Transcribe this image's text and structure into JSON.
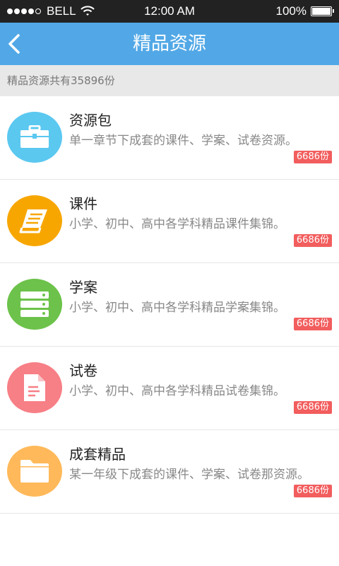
{
  "status_bar": {
    "carrier": "BELL",
    "time": "12:00 AM",
    "battery": "100%"
  },
  "nav": {
    "title": "精品资源",
    "back_icon": "chevron-left-icon"
  },
  "summary": {
    "text": "精品资源共有35896份"
  },
  "colors": {
    "nav_bar": "#52a8e6",
    "badge": "#f25d5d",
    "icon_resource_pack": "#5bc8f0",
    "icon_courseware": "#f7a600",
    "icon_lesson_plan": "#6cc24a",
    "icon_exam": "#f77f86",
    "icon_complete_set": "#ffb95a"
  },
  "items": [
    {
      "title": "资源包",
      "desc": "单一章节下成套的课件、学案、试卷资源。",
      "badge": "6686份",
      "icon": "briefcase-icon"
    },
    {
      "title": "课件",
      "desc": "小学、初中、高中各学科精品课件集锦。",
      "badge": "6686份",
      "icon": "book-icon"
    },
    {
      "title": "学案",
      "desc": "小学、初中、高中各学科精品学案集锦。",
      "badge": "6686份",
      "icon": "server-stack-icon"
    },
    {
      "title": "试卷",
      "desc": "小学、初中、高中各学科精品试卷集锦。",
      "badge": "6686份",
      "icon": "document-icon"
    },
    {
      "title": "成套精品",
      "desc": "某一年级下成套的课件、学案、试卷那资源。",
      "badge": "6686份",
      "icon": "folder-icon"
    }
  ]
}
